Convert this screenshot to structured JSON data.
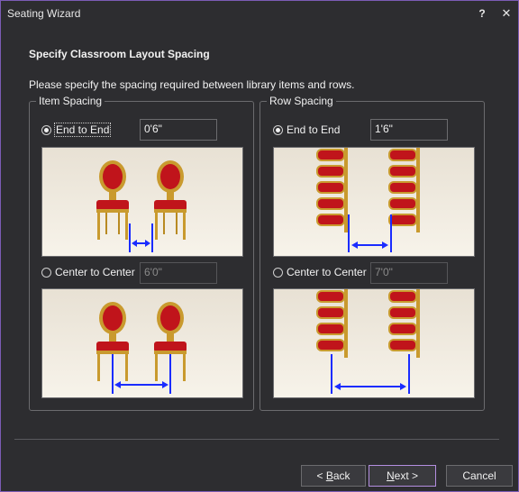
{
  "window": {
    "title": "Seating Wizard",
    "help_label": "?",
    "close_label": "✕"
  },
  "header": {
    "title": "Specify Classroom Layout Spacing",
    "instruction": "Please specify the spacing required between library items and rows."
  },
  "item_spacing": {
    "group_label": "Item Spacing",
    "end_to_end": {
      "label": "End to End",
      "value": "0'6\"",
      "selected": true
    },
    "center_to_center": {
      "label": "Center to Center",
      "value": "6'0\"",
      "selected": false
    }
  },
  "row_spacing": {
    "group_label": "Row Spacing",
    "end_to_end": {
      "label": "End to End",
      "value": "1'6\"",
      "selected": true
    },
    "center_to_center": {
      "label": "Center to Center",
      "value": "7'0\"",
      "selected": false
    }
  },
  "buttons": {
    "back_prefix": "< ",
    "back_key": "B",
    "back_rest": "ack",
    "next_key": "N",
    "next_rest": "ext >",
    "cancel": "Cancel"
  },
  "colors": {
    "accent": "#b48ee0",
    "arrow": "#1a2cff",
    "chair_red": "#c0141b",
    "chair_gold": "#c99a2e"
  }
}
